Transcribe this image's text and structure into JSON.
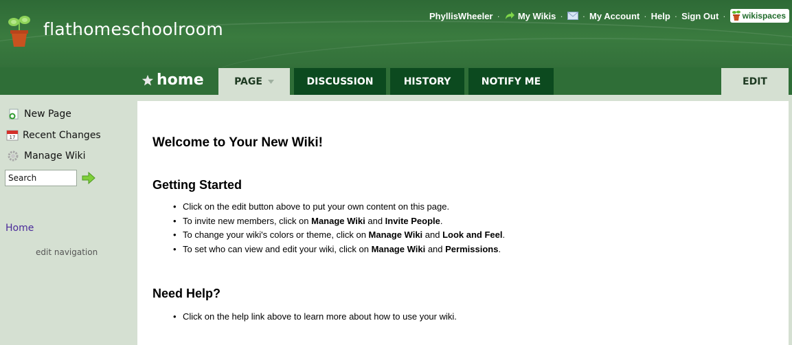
{
  "header": {
    "site_title": "flathomeschoolroom",
    "user": "PhyllisWheeler",
    "my_wikis": "My Wikis",
    "my_account": "My Account",
    "help": "Help",
    "sign_out": "Sign Out",
    "wikispaces": "wikispaces",
    "separator": "·"
  },
  "tabs": {
    "page_name": "home",
    "page": "PAGE",
    "discussion": "DISCUSSION",
    "history": "HISTORY",
    "notify": "NOTIFY ME",
    "edit": "EDIT"
  },
  "sidebar": {
    "new_page": "New Page",
    "recent_changes": "Recent Changes",
    "manage_wiki": "Manage Wiki",
    "search_value": "Search",
    "nav_home": "Home",
    "edit_navigation": "edit navigation"
  },
  "content": {
    "title": "Welcome to Your New Wiki!",
    "getting_started": "Getting Started",
    "gs_items": [
      {
        "a": "Click on the edit button above to put your own content on this page."
      },
      {
        "a": "To invite new members, click on ",
        "b1": "Manage Wiki",
        "c": " and ",
        "b2": "Invite People",
        "d": "."
      },
      {
        "a": "To change your wiki's colors or theme, click on ",
        "b1": "Manage Wiki",
        "c": " and ",
        "b2": "Look and Feel",
        "d": "."
      },
      {
        "a": "To set who can view and edit your wiki, click on ",
        "b1": "Manage Wiki",
        "c": " and ",
        "b2": "Permissions",
        "d": "."
      }
    ],
    "need_help": "Need Help?",
    "help_item": "Click on the help link above to learn more about how to use your wiki."
  },
  "colors": {
    "header_green": "#2e6a36",
    "tab_dark": "#0c4a1f",
    "sidebar_bg": "#d5e0d2",
    "nav_link": "#4a2a9a"
  }
}
